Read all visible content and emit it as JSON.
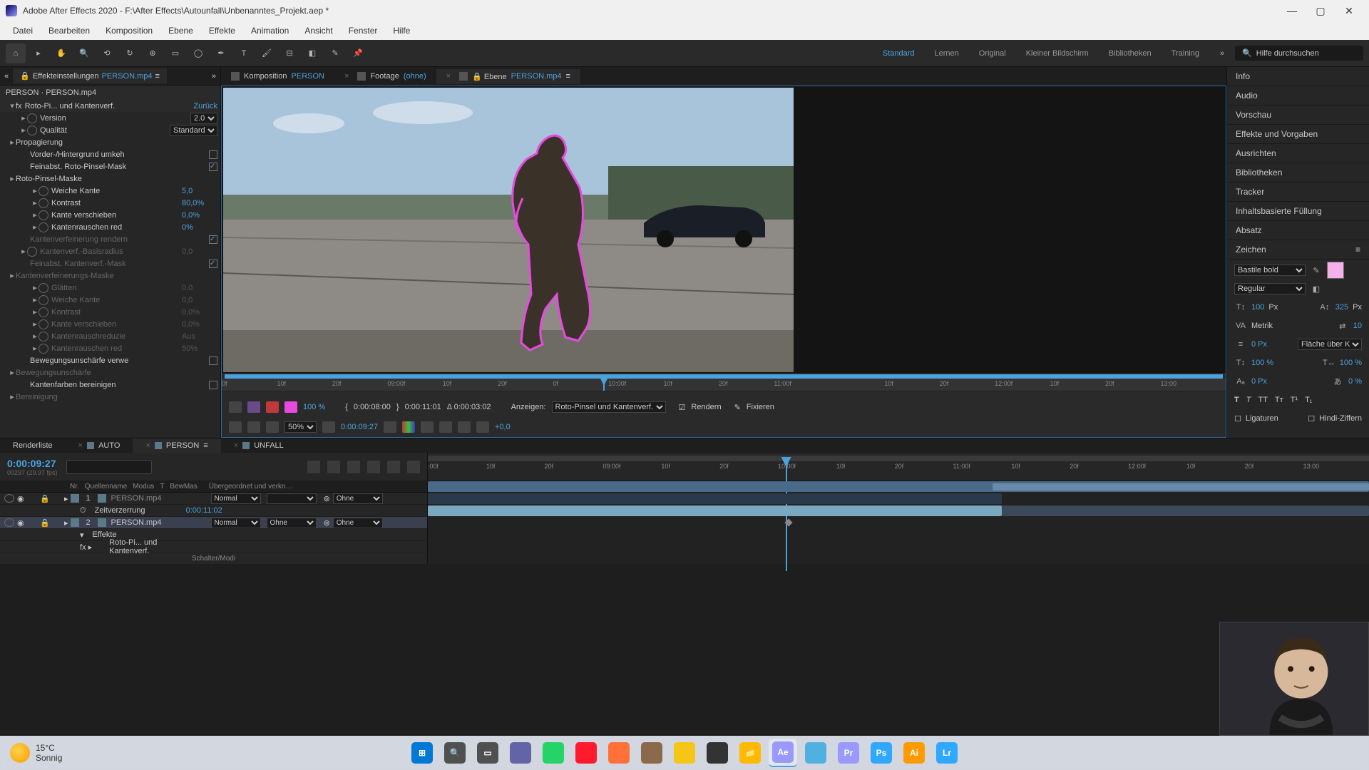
{
  "titlebar": {
    "app": "Adobe After Effects 2020",
    "file": "F:\\After Effects\\Autounfall\\Unbenanntes_Projekt.aep *"
  },
  "menu": [
    "Datei",
    "Bearbeiten",
    "Komposition",
    "Ebene",
    "Effekte",
    "Animation",
    "Ansicht",
    "Fenster",
    "Hilfe"
  ],
  "workspaces": [
    "Standard",
    "Lernen",
    "Original",
    "Kleiner Bildschirm",
    "Bibliotheken",
    "Training"
  ],
  "search_placeholder": "Hilfe durchsuchen",
  "effect_panel": {
    "tab_label": "Effekteinstellungen",
    "tab_layer": "PERSON.mp4",
    "header": "PERSON · PERSON.mp4",
    "fx_name": "Roto-Pi... und Kantenverf.",
    "reset": "Zurück",
    "rows": [
      {
        "label": "Version",
        "value": "2.0",
        "type": "select",
        "indent": 1
      },
      {
        "label": "Qualität",
        "value": "Standard",
        "type": "select",
        "indent": 1
      },
      {
        "label": "Propagierung",
        "type": "group",
        "indent": 0
      },
      {
        "label": "Vorder-/Hintergrund umkeh",
        "type": "check",
        "checked": false,
        "indent": 1
      },
      {
        "label": "Feinabst. Roto-Pinsel-Mask",
        "type": "check",
        "checked": true,
        "indent": 1
      },
      {
        "label": "Roto-Pinsel-Maske",
        "type": "group",
        "indent": 0
      },
      {
        "label": "Weiche Kante",
        "value": "5,0",
        "type": "prop",
        "indent": 2
      },
      {
        "label": "Kontrast",
        "value": "80,0%",
        "type": "prop",
        "indent": 2
      },
      {
        "label": "Kante verschieben",
        "value": "0,0%",
        "type": "prop",
        "indent": 2
      },
      {
        "label": "Kantenrauschen red",
        "value": "0%",
        "type": "prop",
        "indent": 2
      },
      {
        "label": "Kantenverfeinerung rendern",
        "type": "check",
        "checked": true,
        "indent": 1,
        "dim": true
      },
      {
        "label": "Kantenverf.-Basisradius",
        "value": "0,0",
        "indent": 1,
        "dim": true
      },
      {
        "label": "Feinabst. Kantenverf.-Mask",
        "type": "check",
        "checked": true,
        "indent": 1,
        "dim": true
      },
      {
        "label": "Kantenverfeinerungs-Maske",
        "type": "group",
        "indent": 0,
        "dim": true
      },
      {
        "label": "Glätten",
        "value": "0,0",
        "indent": 2,
        "dim": true
      },
      {
        "label": "Weiche Kante",
        "value": "0,0",
        "indent": 2,
        "dim": true
      },
      {
        "label": "Kontrast",
        "value": "0,0%",
        "indent": 2,
        "dim": true
      },
      {
        "label": "Kante verschieben",
        "value": "0,0%",
        "indent": 2,
        "dim": true
      },
      {
        "label": "Kantenrauschreduzie",
        "value": "Aus",
        "indent": 2,
        "dim": true
      },
      {
        "label": "Kantenrauschen red",
        "value": "50%",
        "indent": 2,
        "dim": true
      },
      {
        "label": "Bewegungsunschärfe verwe",
        "type": "check",
        "checked": false,
        "indent": 1
      },
      {
        "label": "Bewegungsunschärfe",
        "type": "group",
        "indent": 0,
        "dim": true
      },
      {
        "label": "Kantenfarben bereinigen",
        "type": "check",
        "checked": false,
        "indent": 1
      },
      {
        "label": "Bereinigung",
        "type": "group",
        "indent": 0,
        "dim": true
      }
    ]
  },
  "viewer": {
    "tabs": [
      {
        "type": "Komposition",
        "name": "PERSON"
      },
      {
        "type": "Footage",
        "name": "(ohne)"
      },
      {
        "type": "Ebene",
        "name": "PERSON.mp4"
      }
    ],
    "active_tab": 2,
    "ruler_ticks": [
      "0f",
      "10f",
      "20f",
      "09:00f",
      "10f",
      "20f",
      "0f",
      "10:00f",
      "10f",
      "20f",
      "11:00f",
      "",
      "10f",
      "20f",
      "12:00f",
      "10f",
      "20f",
      "13:00"
    ],
    "footer": {
      "zoom": "50%",
      "current_time": "0:00:09:27",
      "in_time": "0:00:08:00",
      "out_time": "0:00:11:01",
      "duration": "Δ 0:00:03:02",
      "view_label": "Anzeigen:",
      "view_mode": "Roto-Pinsel und Kantenverf.",
      "percent": "100 %",
      "render_label": "Rendern",
      "freeze_label": "Fixieren",
      "res_label": "+0,0"
    }
  },
  "right_panels": [
    "Info",
    "Audio",
    "Vorschau",
    "Effekte und Vorgaben",
    "Ausrichten",
    "Bibliotheken",
    "Tracker",
    "Inhaltsbasierte Füllung",
    "Absatz"
  ],
  "char_panel": {
    "title": "Zeichen",
    "font": "Bastile bold",
    "style": "Regular",
    "size": "100",
    "size_unit": "Px",
    "leading": "325",
    "leading_unit": "Px",
    "kerning": "Metrik",
    "tracking": "10",
    "baseline_px": "0 Px",
    "fill_label": "Fläche über Kon…",
    "vscale": "100 %",
    "hscale": "100 %",
    "baseline": "0 Px",
    "tsume": "0 %",
    "ligatures": "Ligaturen",
    "hindi": "Hindi-Ziffern",
    "swatch_color": "#f4b0e8"
  },
  "timeline": {
    "tabs": [
      "Renderliste",
      "AUTO",
      "PERSON",
      "UNFALL"
    ],
    "active_tab": 2,
    "current_time": "0:00:09:27",
    "sub_time": "00297 (29.97 fps)",
    "cols": [
      "Nr.",
      "Quellenname",
      "Modus",
      "T",
      "BewMas",
      "",
      "Übergeordnet und verkn…"
    ],
    "layers": [
      {
        "num": "1",
        "name": "PERSON.mp4",
        "mode": "Normal",
        "trk": "",
        "parent": "Ohne",
        "dim": true
      },
      {
        "num": "",
        "name": "Zeitverzerrung",
        "value": "0:00:11:02",
        "indent": true,
        "time_row": true
      },
      {
        "num": "2",
        "name": "PERSON.mp4",
        "mode": "Normal",
        "trk": "Ohne",
        "parent": "Ohne",
        "selected": true
      },
      {
        "num": "",
        "name": "Effekte",
        "indent": true
      },
      {
        "num": "",
        "name": "Roto-Pi... und Kantenverf.",
        "indent": true,
        "fx": true
      }
    ],
    "footer": "Schalter/Modi",
    "ruler_ticks": [
      ":00f",
      "10f",
      "20f",
      "09:00f",
      "10f",
      "20f",
      "10:00f",
      "10f",
      "20f",
      "11:00f",
      "10f",
      "20f",
      "12:00f",
      "10f",
      "20f",
      "13:00"
    ]
  },
  "taskbar": {
    "temp": "15°C",
    "cond": "Sonnig",
    "apps": [
      "windows",
      "search",
      "taskview",
      "teams",
      "whatsapp",
      "opera",
      "firefox",
      "app1",
      "studio",
      "clock",
      "files",
      "ae",
      "notes",
      "pr",
      "ps",
      "ai",
      "lr"
    ]
  }
}
